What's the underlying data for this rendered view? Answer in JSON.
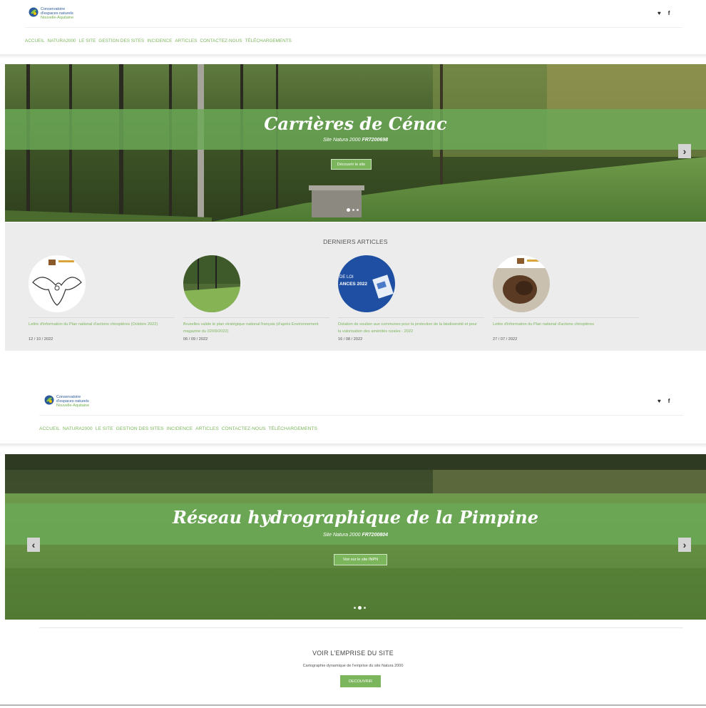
{
  "header": {
    "logo": {
      "line1": "Conservatoire",
      "line2": "d'espaces naturels",
      "line3": "Nouvelle-Aquitaine"
    },
    "social": {
      "twitter": "♥",
      "facebook": "f"
    },
    "nav": [
      "ACCUEIL",
      "NATURA2000",
      "LE SITE",
      "GESTION DES SITES",
      "INCIDENCE",
      "ARTICLES",
      "CONTACTEZ-NOUS",
      "TÉLÉCHARGEMENTS"
    ]
  },
  "hero1": {
    "title": "Carrières de Cénac",
    "sub_prefix": "Site Natura 2000",
    "sub_code": "FR7200698",
    "button": "Découvrir le site"
  },
  "articles": {
    "title": "DERNIERS ARTICLES",
    "items": [
      {
        "title": "Lettre d'information du Plan national d'actions chiroptères (Octobre 2022)",
        "date": "12 / 10 / 2022"
      },
      {
        "title": "Bruxelles valide le plan stratégique national français (d'après Environnement magazine du 02/09/2022)",
        "date": "06 / 09 / 2022"
      },
      {
        "title": "Dotation de soutien aux communes pour la protection de la biodiversité et pour la valorisation des aménités rurales - 2022",
        "date": "16 / 08 / 2022",
        "image_text": [
          "DE LOI",
          "ANCES 2022"
        ]
      },
      {
        "title": "Lettre d'information du Plan national d'actions chiroptères",
        "date": "27 / 07 / 2022"
      }
    ]
  },
  "hero2": {
    "title": "Réseau hydrographique de la Pimpine",
    "sub_prefix": "Site Natura 2000",
    "sub_code": "FR7200804",
    "button": "Voir sur le site INPN"
  },
  "arrows": {
    "prev": "‹",
    "next": "›"
  },
  "emprise": {
    "title": "VOIR L'EMPRISE DU SITE",
    "sub": "Cartographie dynamique de l'emprise du site Natura 2000",
    "button": "DECOUVRIR"
  },
  "colors": {
    "accent": "#7cb65c",
    "band": "#6baa57",
    "logo_blue": "#2a5a9a"
  }
}
